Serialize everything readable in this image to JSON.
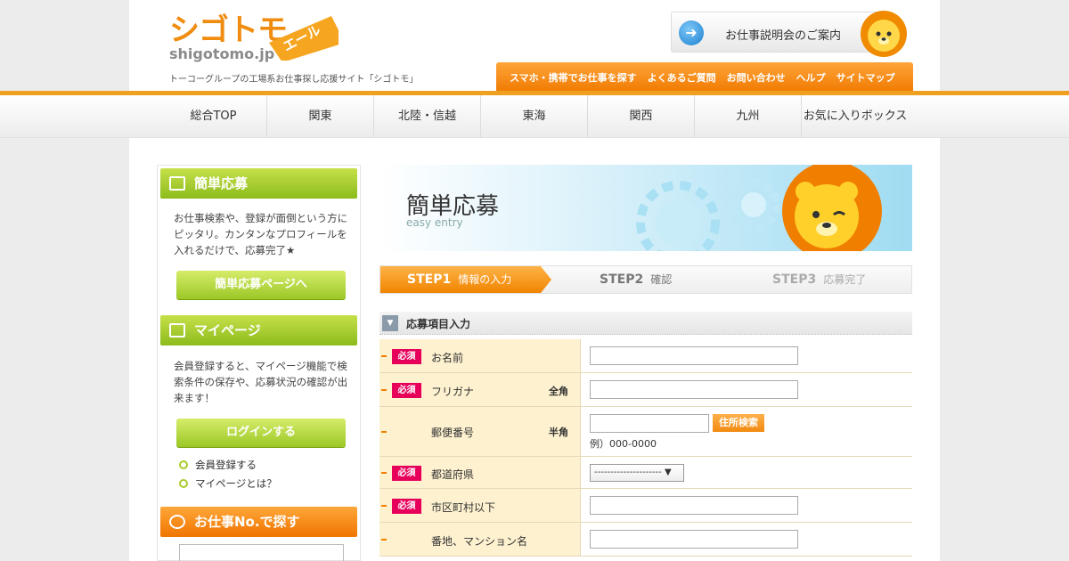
{
  "header": {
    "logo_main": "シゴトモ",
    "logo_tag": "エール",
    "logo_domain": "shigotomo.jp",
    "tagline": "トーコーグループの工場系お仕事探し応援サイト「シゴトモ」",
    "seminar_label": "お仕事説明会のご案内",
    "top_links": [
      "スマホ・携帯でお仕事を探す",
      "よくあるご質問",
      "お問い合わせ",
      "ヘルプ",
      "サイトマップ"
    ]
  },
  "global_nav": [
    "総合TOP",
    "関東",
    "北陸・信越",
    "東海",
    "関西",
    "九州",
    "お気に入りボックス"
  ],
  "sidebar": {
    "easy_entry": {
      "title": "簡単応募",
      "text": "お仕事検索や、登録が面倒という方にピッタリ。カンタンなプロフィールを入れるだけで、応募完了★",
      "button": "簡単応募ページへ"
    },
    "mypage": {
      "title": "マイページ",
      "text": "会員登録すると、マイページ機能で検索条件の保存や、応募状況の確認が出来ます！",
      "button": "ログインする",
      "links": [
        "会員登録する",
        "マイページとは？"
      ]
    },
    "job_search": {
      "title": "お仕事No.で探す"
    }
  },
  "banner": {
    "title": "簡単応募",
    "subtitle": "easy entry"
  },
  "steps": [
    {
      "num": "STEP1",
      "label": "情報の入力"
    },
    {
      "num": "STEP2",
      "label": "確認"
    },
    {
      "num": "STEP3",
      "label": "応募完了"
    }
  ],
  "form": {
    "section_title": "応募項目入力",
    "required_label": "必須",
    "fields": {
      "name": {
        "label": "お名前"
      },
      "furigana": {
        "label": "フリガナ",
        "type_note": "全角"
      },
      "postal": {
        "label": "郵便番号",
        "type_note": "半角",
        "button": "住所検索",
        "hint": "例）000-0000"
      },
      "prefecture": {
        "label": "都道府県",
        "select_value": "--------------------- ▼"
      },
      "city": {
        "label": "市区町村以下"
      },
      "address": {
        "label": "番地、マンション名"
      }
    }
  }
}
